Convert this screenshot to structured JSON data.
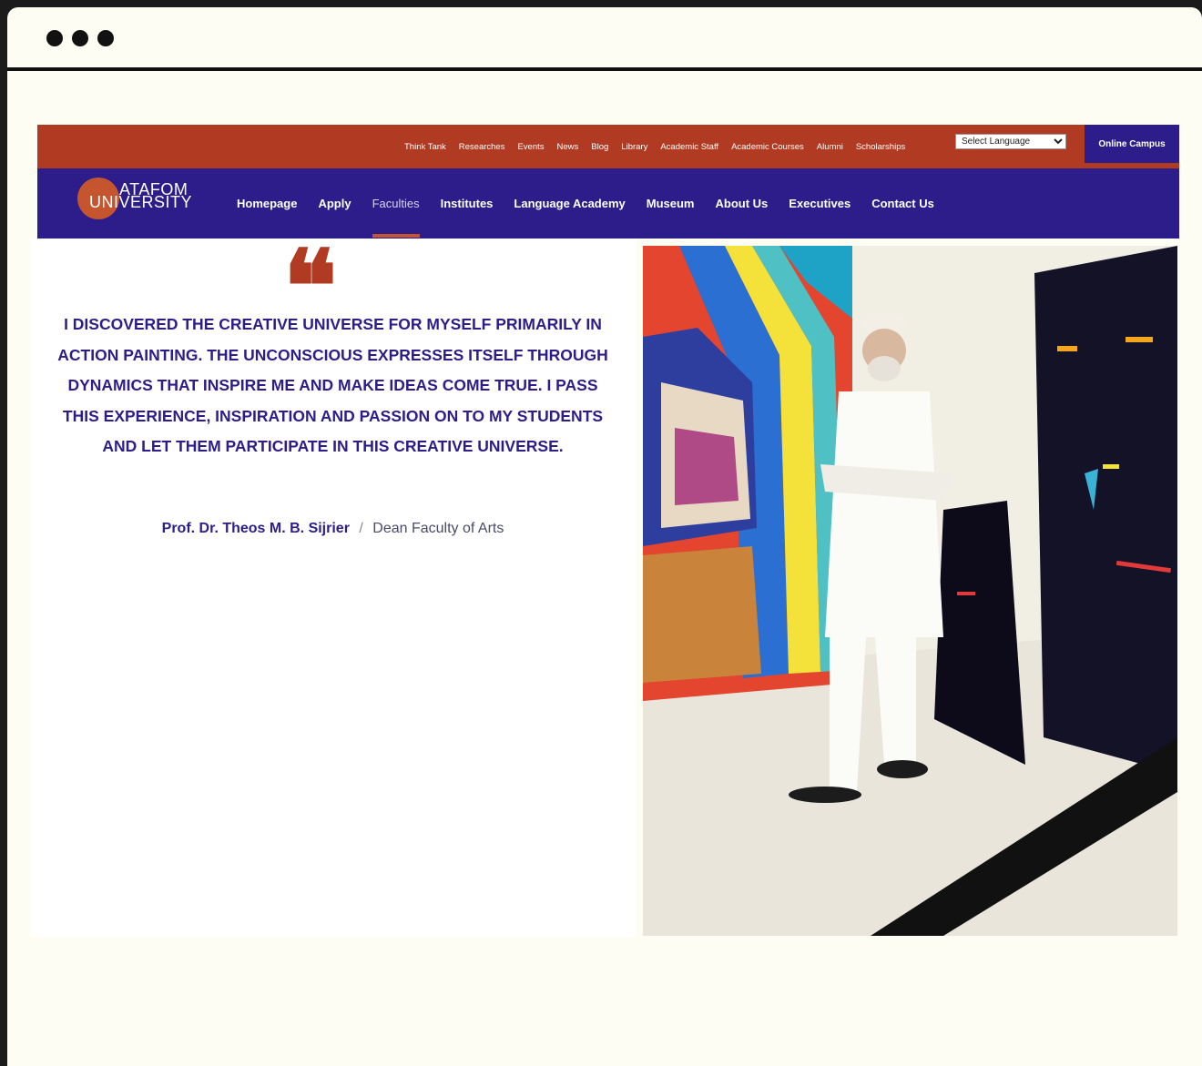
{
  "window": {
    "controls": [
      "dot",
      "dot",
      "dot"
    ]
  },
  "topbar": {
    "links": [
      "Think Tank",
      "Researches",
      "Events",
      "News",
      "Blog",
      "Library",
      "Academic Staff",
      "Academic Courses",
      "Alumni",
      "Scholarships"
    ],
    "language_select": "Select Language",
    "online_campus": "Online Campus"
  },
  "logo": {
    "line1": "ATAFOM",
    "line2": "UNIVERSITY"
  },
  "nav": {
    "items": [
      "Homepage",
      "Apply",
      "Faculties",
      "Institutes",
      "Language Academy",
      "Museum",
      "About Us",
      "Executives",
      "Contact Us"
    ],
    "active": "Faculties"
  },
  "quote": {
    "mark": "❝",
    "text": "I DISCOVERED THE CREATIVE UNIVERSE FOR MYSELF PRIMARILY IN ACTION PAINTING. THE UNCONSCIOUS EXPRESSES ITSELF THROUGH DYNAMICS THAT INSPIRE ME AND MAKE IDEAS COME TRUE. I PASS THIS EXPERIENCE, INSPIRATION AND PASSION ON TO MY STUDENTS AND LET THEM PARTICIPATE IN THIS CREATIVE UNIVERSE.",
    "author_name": "Prof. Dr. Theos M. B. Sijrier",
    "separator": "/",
    "author_role": "Dean Faculty of Arts"
  },
  "colors": {
    "brand_red": "#b13a22",
    "brand_blue": "#2c1d8a"
  }
}
